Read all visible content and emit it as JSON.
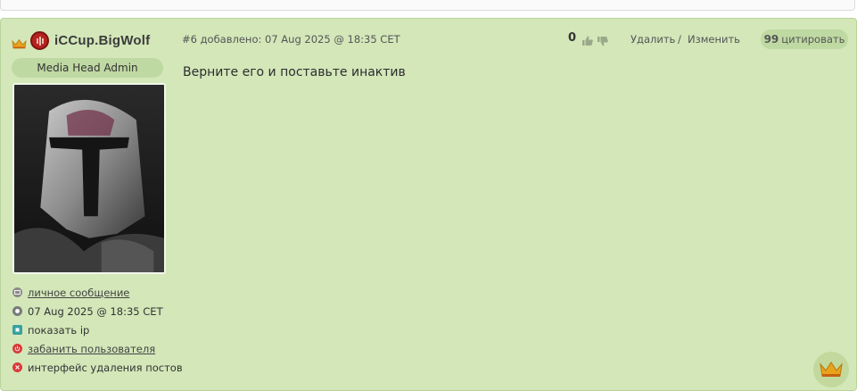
{
  "user": {
    "name": "iCCup.BigWolf",
    "role": "Media Head Admin"
  },
  "user_links": [
    {
      "label": "личное сообщение",
      "icon": "mail-icon",
      "color": "#8a8a8a"
    },
    {
      "label": "07 Aug 2025 @ 18:35 CET",
      "icon": "clock-icon",
      "color": "#7a7a7a"
    },
    {
      "label": "показать ip",
      "icon": "ip-icon",
      "color": "#3aa0a0"
    },
    {
      "label": "забанить пользователя",
      "icon": "power-icon",
      "color": "#d93a3a"
    },
    {
      "label": "интерфейс удаления постов",
      "icon": "delete-x-icon",
      "color": "#d93a3a"
    }
  ],
  "post": {
    "meta": "#6 добавлено: 07 Aug 2025 @ 18:35 CET",
    "rating": "0",
    "delete_label": "Удалить",
    "separator": "/",
    "edit_label": "Изменить",
    "quote_icon": "99",
    "quote_label": "цитировать",
    "body": "Верните его и поставьте инактив"
  },
  "colors": {
    "post_bg": "#d3e7b9",
    "badge_bg": "#bfd9a3",
    "race_red": "#b7231f",
    "crown_gold": "#e8a21c"
  }
}
